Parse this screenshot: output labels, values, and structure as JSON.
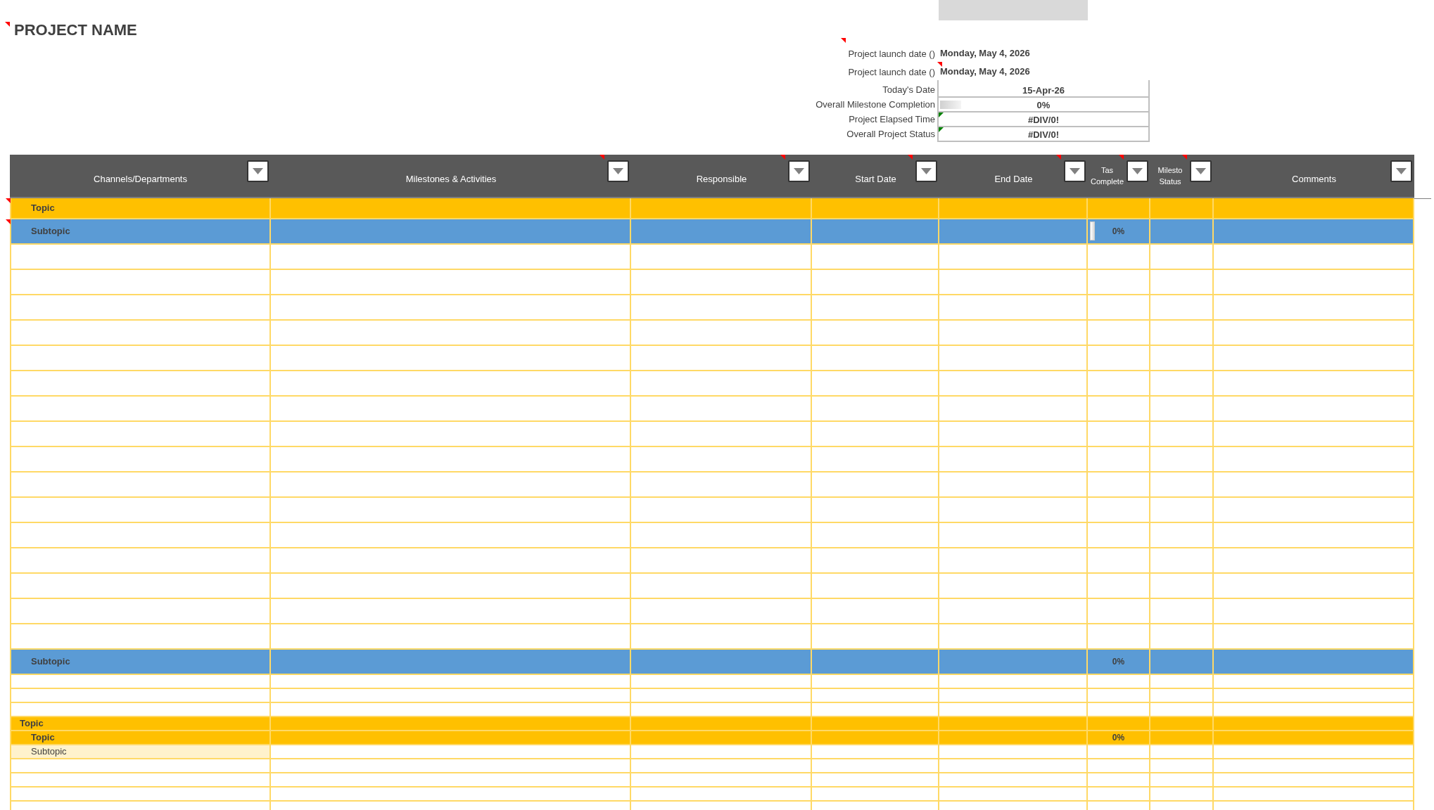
{
  "title": {
    "text": "PROJECT NAME",
    "comment": true
  },
  "info": [
    {
      "label": "Project launch date ()",
      "value": "Monday, May 4, 2026",
      "boxed": false,
      "label_comment": true,
      "value_comment": false,
      "error_flag": false,
      "bar": false
    },
    {
      "label": "Project launch date ()",
      "value": "Monday, May 4, 2026",
      "boxed": false,
      "label_comment": false,
      "value_comment": true,
      "error_flag": false,
      "bar": false
    },
    {
      "label": "Today's Date",
      "value": "15-Apr-26",
      "boxed": true,
      "label_comment": false,
      "value_comment": false,
      "error_flag": false,
      "bar": false
    },
    {
      "label": "Overall Milestone Completion",
      "value": "0%",
      "boxed": true,
      "label_comment": false,
      "value_comment": false,
      "error_flag": false,
      "bar": true
    },
    {
      "label": "Project Elapsed Time",
      "value": "#DIV/0!",
      "boxed": true,
      "label_comment": false,
      "value_comment": false,
      "error_flag": true,
      "bar": false
    },
    {
      "label": "Overall Project Status",
      "value": "#DIV/0!",
      "boxed": true,
      "label_comment": false,
      "value_comment": false,
      "error_flag": true,
      "bar": false
    }
  ],
  "table": {
    "columns": [
      {
        "label": [
          "Channels/Departments"
        ],
        "comment": false
      },
      {
        "label": [
          "Milestones & Activities"
        ],
        "comment": true
      },
      {
        "label": [
          "Responsible"
        ],
        "comment": true
      },
      {
        "label": [
          "Start Date"
        ],
        "comment": true
      },
      {
        "label": [
          "End Date"
        ],
        "comment": true
      },
      {
        "label": [
          "Tas",
          "Complete"
        ],
        "comment": true
      },
      {
        "label": [
          "Milesto",
          "Status"
        ],
        "comment": true
      },
      {
        "label": [
          "Comments"
        ],
        "comment": false
      }
    ],
    "rows": [
      {
        "kind": "topic",
        "label": "Topic",
        "compact": false,
        "comment": true
      },
      {
        "kind": "subtopic",
        "label": "Subtopic",
        "task_complete": "0%",
        "compact": false,
        "comment": true,
        "bar": true
      },
      {
        "kind": "blank",
        "compact": false,
        "comment": false
      },
      {
        "kind": "blank",
        "compact": false,
        "comment": false
      },
      {
        "kind": "blank",
        "compact": false,
        "comment": false
      },
      {
        "kind": "blank",
        "compact": false,
        "comment": false
      },
      {
        "kind": "blank",
        "compact": false,
        "comment": false
      },
      {
        "kind": "blank",
        "compact": false,
        "comment": false
      },
      {
        "kind": "blank",
        "compact": false,
        "comment": false
      },
      {
        "kind": "blank",
        "compact": false,
        "comment": false
      },
      {
        "kind": "blank",
        "compact": false,
        "comment": false
      },
      {
        "kind": "blank",
        "compact": false,
        "comment": false
      },
      {
        "kind": "blank",
        "compact": false,
        "comment": false
      },
      {
        "kind": "blank",
        "compact": false,
        "comment": false
      },
      {
        "kind": "blank",
        "compact": false,
        "comment": false
      },
      {
        "kind": "blank",
        "compact": false,
        "comment": false
      },
      {
        "kind": "blank",
        "compact": false,
        "comment": false
      },
      {
        "kind": "blank",
        "compact": false,
        "comment": false
      },
      {
        "kind": "subtopic",
        "label": "Subtopic",
        "task_complete": "0%",
        "compact": false,
        "comment": false,
        "bar": false
      },
      {
        "kind": "blank",
        "compact": true,
        "comment": false
      },
      {
        "kind": "blank",
        "compact": true,
        "comment": false
      },
      {
        "kind": "blank",
        "compact": true,
        "comment": false
      },
      {
        "kind": "group",
        "label": "Topic",
        "compact": true,
        "comment": false
      },
      {
        "kind": "topic",
        "label": "Topic",
        "task_complete": "0%",
        "compact": true,
        "comment": false
      },
      {
        "kind": "item",
        "label": "Subtopic",
        "compact": true,
        "comment": false
      },
      {
        "kind": "blank",
        "compact": true,
        "comment": false
      },
      {
        "kind": "blank",
        "compact": true,
        "comment": false
      },
      {
        "kind": "blank",
        "compact": true,
        "comment": false
      },
      {
        "kind": "blank",
        "compact": true,
        "comment": false
      }
    ]
  }
}
